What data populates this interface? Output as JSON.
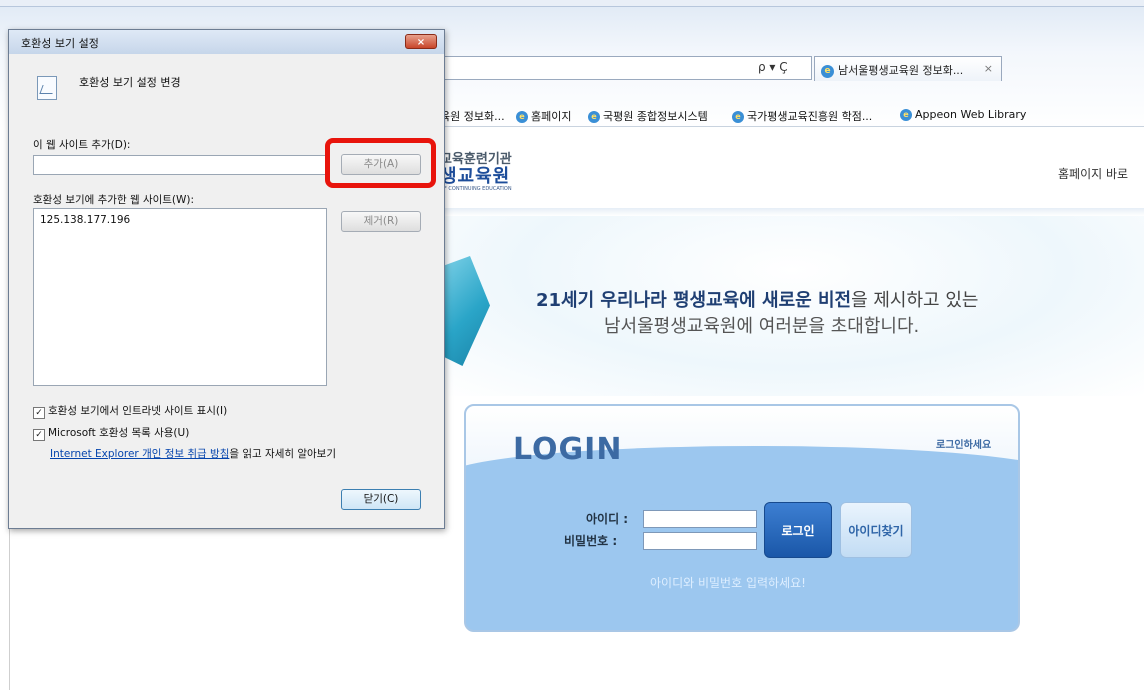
{
  "browser": {
    "tab_title": "남서울평생교육원 정보화...",
    "tab_close": "×",
    "addr_icons": "ρ ▾ Ç",
    "favorites": [
      {
        "label": "육원 정보화..."
      },
      {
        "label": "홈페이지"
      },
      {
        "label": "국평원 종합정보시스템"
      },
      {
        "label": "국가평생교육진흥원 학점..."
      },
      {
        "label": "Appeon Web Library"
      }
    ]
  },
  "site": {
    "logo_line1": "교육훈련기관",
    "logo_line2": "생교육원",
    "logo_line3": "OF CONTINUING EDUCATION",
    "home_link": "홈페이지 바로",
    "hero_line1_bold1": "21세기 우리나라 평생교육에 새로운 비전",
    "hero_line1_rest": "을 제시하고 있는",
    "hero_line2": "남서울평생교육원에 여러분을 초대합니다.",
    "login": {
      "title": "LOGIN",
      "subtitle": "로그인하세요",
      "id_label": "아이디 :",
      "pw_label": "비밀번호 :",
      "login_button": "로그인",
      "find_id_button": "아이디찾기",
      "hint": "아이디와 비밀번호 입력하세요!"
    }
  },
  "dialog": {
    "title": "호환성 보기 설정",
    "close": "×",
    "header": "호환성 보기 설정 변경",
    "add_site_label": "이 웹 사이트 추가(D):",
    "add_site_value": "",
    "add_button": "추가(A)",
    "list_label": "호환성 보기에 추가한 웹 사이트(W):",
    "remove_button": "제거(R)",
    "sites": [
      "125.138.177.196"
    ],
    "check_intranet": {
      "checked": true,
      "label": "호환성 보기에서 인트라넷 사이트 표시(I)"
    },
    "check_ms_list": {
      "checked": true,
      "label": "Microsoft 호환성 목록 사용(U)"
    },
    "privacy_link": "Internet Explorer 개인 정보 취급 방침",
    "privacy_suffix": "을 읽고 자세히 알아보기",
    "close_button": "닫기(C)",
    "checkmark": "✓"
  }
}
